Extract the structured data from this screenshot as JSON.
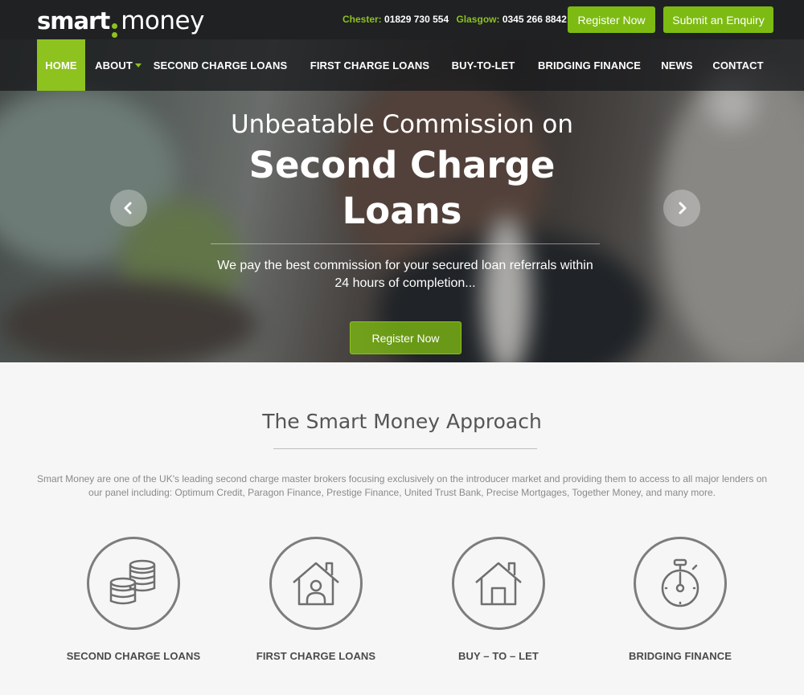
{
  "brand": {
    "logo_part1": "smart",
    "logo_part2": "money",
    "accent": "#8dc21f"
  },
  "header": {
    "contacts": [
      {
        "city": "Chester:",
        "phone": "01829 730 554"
      },
      {
        "city": "Glasgow:",
        "phone": "0345 266 8842"
      }
    ],
    "register_label": "Register Now",
    "enquiry_label": "Submit an Enquiry"
  },
  "nav": {
    "items": [
      "HOME",
      "ABOUT",
      "SECOND CHARGE LOANS",
      "FIRST CHARGE LOANS",
      "BUY-TO-LET",
      "BRIDGING FINANCE",
      "NEWS",
      "CONTACT"
    ],
    "active": "HOME"
  },
  "hero": {
    "line1": "Unbeatable Commission on",
    "line2": "Second Charge Loans",
    "subtitle": "We pay the best commission for your secured loan referrals within 24 hours of completion...",
    "cta_label": "Register Now"
  },
  "approach": {
    "title": "The Smart Money Approach",
    "description": "Smart Money are one of the UK's leading second charge master brokers focusing exclusively on the introducer market and providing them to access to all major lenders on our panel including: Optimum Credit, Paragon Finance, Prestige Finance, United Trust Bank, Precise Mortgages, Together Money, and many more.",
    "features": [
      {
        "label": "SECOND CHARGE LOANS",
        "icon": "coins-stack-icon"
      },
      {
        "label": "FIRST CHARGE LOANS",
        "icon": "house-person-icon"
      },
      {
        "label": "BUY – TO – LET",
        "icon": "house-icon"
      },
      {
        "label": "BRIDGING FINANCE",
        "icon": "stopwatch-icon"
      }
    ]
  }
}
